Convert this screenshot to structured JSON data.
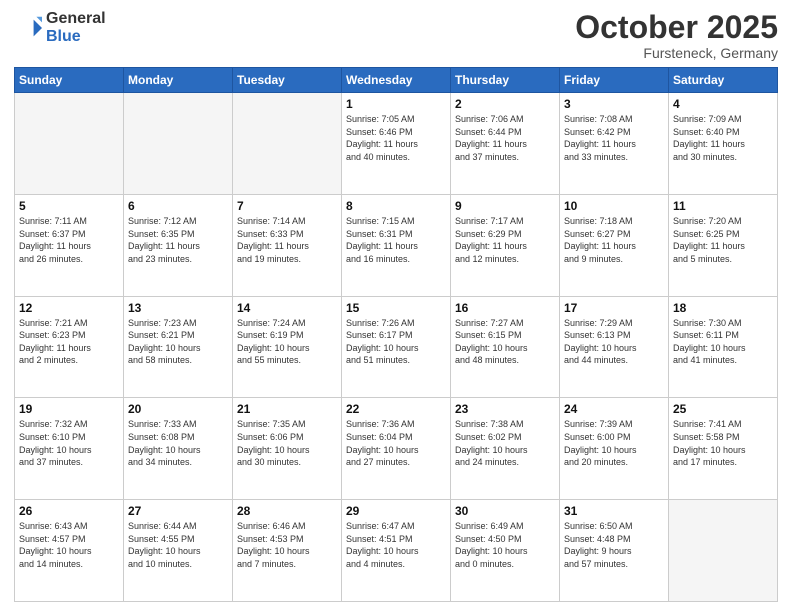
{
  "logo": {
    "line1": "General",
    "line2": "Blue"
  },
  "title": "October 2025",
  "subtitle": "Fursteneck, Germany",
  "weekdays": [
    "Sunday",
    "Monday",
    "Tuesday",
    "Wednesday",
    "Thursday",
    "Friday",
    "Saturday"
  ],
  "weeks": [
    [
      {
        "day": "",
        "detail": ""
      },
      {
        "day": "",
        "detail": ""
      },
      {
        "day": "",
        "detail": ""
      },
      {
        "day": "1",
        "detail": "Sunrise: 7:05 AM\nSunset: 6:46 PM\nDaylight: 11 hours\nand 40 minutes."
      },
      {
        "day": "2",
        "detail": "Sunrise: 7:06 AM\nSunset: 6:44 PM\nDaylight: 11 hours\nand 37 minutes."
      },
      {
        "day": "3",
        "detail": "Sunrise: 7:08 AM\nSunset: 6:42 PM\nDaylight: 11 hours\nand 33 minutes."
      },
      {
        "day": "4",
        "detail": "Sunrise: 7:09 AM\nSunset: 6:40 PM\nDaylight: 11 hours\nand 30 minutes."
      }
    ],
    [
      {
        "day": "5",
        "detail": "Sunrise: 7:11 AM\nSunset: 6:37 PM\nDaylight: 11 hours\nand 26 minutes."
      },
      {
        "day": "6",
        "detail": "Sunrise: 7:12 AM\nSunset: 6:35 PM\nDaylight: 11 hours\nand 23 minutes."
      },
      {
        "day": "7",
        "detail": "Sunrise: 7:14 AM\nSunset: 6:33 PM\nDaylight: 11 hours\nand 19 minutes."
      },
      {
        "day": "8",
        "detail": "Sunrise: 7:15 AM\nSunset: 6:31 PM\nDaylight: 11 hours\nand 16 minutes."
      },
      {
        "day": "9",
        "detail": "Sunrise: 7:17 AM\nSunset: 6:29 PM\nDaylight: 11 hours\nand 12 minutes."
      },
      {
        "day": "10",
        "detail": "Sunrise: 7:18 AM\nSunset: 6:27 PM\nDaylight: 11 hours\nand 9 minutes."
      },
      {
        "day": "11",
        "detail": "Sunrise: 7:20 AM\nSunset: 6:25 PM\nDaylight: 11 hours\nand 5 minutes."
      }
    ],
    [
      {
        "day": "12",
        "detail": "Sunrise: 7:21 AM\nSunset: 6:23 PM\nDaylight: 11 hours\nand 2 minutes."
      },
      {
        "day": "13",
        "detail": "Sunrise: 7:23 AM\nSunset: 6:21 PM\nDaylight: 10 hours\nand 58 minutes."
      },
      {
        "day": "14",
        "detail": "Sunrise: 7:24 AM\nSunset: 6:19 PM\nDaylight: 10 hours\nand 55 minutes."
      },
      {
        "day": "15",
        "detail": "Sunrise: 7:26 AM\nSunset: 6:17 PM\nDaylight: 10 hours\nand 51 minutes."
      },
      {
        "day": "16",
        "detail": "Sunrise: 7:27 AM\nSunset: 6:15 PM\nDaylight: 10 hours\nand 48 minutes."
      },
      {
        "day": "17",
        "detail": "Sunrise: 7:29 AM\nSunset: 6:13 PM\nDaylight: 10 hours\nand 44 minutes."
      },
      {
        "day": "18",
        "detail": "Sunrise: 7:30 AM\nSunset: 6:11 PM\nDaylight: 10 hours\nand 41 minutes."
      }
    ],
    [
      {
        "day": "19",
        "detail": "Sunrise: 7:32 AM\nSunset: 6:10 PM\nDaylight: 10 hours\nand 37 minutes."
      },
      {
        "day": "20",
        "detail": "Sunrise: 7:33 AM\nSunset: 6:08 PM\nDaylight: 10 hours\nand 34 minutes."
      },
      {
        "day": "21",
        "detail": "Sunrise: 7:35 AM\nSunset: 6:06 PM\nDaylight: 10 hours\nand 30 minutes."
      },
      {
        "day": "22",
        "detail": "Sunrise: 7:36 AM\nSunset: 6:04 PM\nDaylight: 10 hours\nand 27 minutes."
      },
      {
        "day": "23",
        "detail": "Sunrise: 7:38 AM\nSunset: 6:02 PM\nDaylight: 10 hours\nand 24 minutes."
      },
      {
        "day": "24",
        "detail": "Sunrise: 7:39 AM\nSunset: 6:00 PM\nDaylight: 10 hours\nand 20 minutes."
      },
      {
        "day": "25",
        "detail": "Sunrise: 7:41 AM\nSunset: 5:58 PM\nDaylight: 10 hours\nand 17 minutes."
      }
    ],
    [
      {
        "day": "26",
        "detail": "Sunrise: 6:43 AM\nSunset: 4:57 PM\nDaylight: 10 hours\nand 14 minutes."
      },
      {
        "day": "27",
        "detail": "Sunrise: 6:44 AM\nSunset: 4:55 PM\nDaylight: 10 hours\nand 10 minutes."
      },
      {
        "day": "28",
        "detail": "Sunrise: 6:46 AM\nSunset: 4:53 PM\nDaylight: 10 hours\nand 7 minutes."
      },
      {
        "day": "29",
        "detail": "Sunrise: 6:47 AM\nSunset: 4:51 PM\nDaylight: 10 hours\nand 4 minutes."
      },
      {
        "day": "30",
        "detail": "Sunrise: 6:49 AM\nSunset: 4:50 PM\nDaylight: 10 hours\nand 0 minutes."
      },
      {
        "day": "31",
        "detail": "Sunrise: 6:50 AM\nSunset: 4:48 PM\nDaylight: 9 hours\nand 57 minutes."
      },
      {
        "day": "",
        "detail": ""
      }
    ]
  ]
}
